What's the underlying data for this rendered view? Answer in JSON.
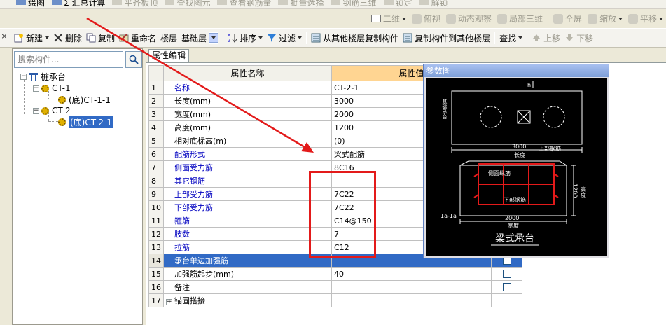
{
  "toolbar_top": {
    "items": [
      {
        "label": "绘图",
        "icon": "draw-icon",
        "disabled": false
      },
      {
        "label": "Σ 汇总计算",
        "icon": "sum-icon",
        "disabled": false
      },
      {
        "label": "平齐板顶",
        "icon": "align-top-icon",
        "disabled": true
      },
      {
        "label": "查找图元",
        "icon": "find-element-icon",
        "disabled": true
      },
      {
        "label": "查看钢筋量",
        "icon": "view-rebar-icon",
        "disabled": true
      },
      {
        "label": "批量选择",
        "icon": "batch-select-icon",
        "disabled": true
      },
      {
        "label": "钢筋三维",
        "icon": "rebar-3d-icon",
        "disabled": true
      },
      {
        "label": "锁定",
        "icon": "lock-icon",
        "disabled": true
      },
      {
        "label": "解锁",
        "icon": "unlock-icon",
        "disabled": true
      }
    ]
  },
  "toolbar_view": {
    "view_mode": "二维",
    "items": [
      {
        "label": "俯视",
        "icon": "top-view-icon"
      },
      {
        "label": "动态观察",
        "icon": "orbit-icon"
      },
      {
        "label": "局部三维",
        "icon": "local-3d-icon"
      },
      {
        "label": "全屏",
        "icon": "fullscreen-icon"
      },
      {
        "label": "缩放",
        "icon": "zoom-icon"
      },
      {
        "label": "平移",
        "icon": "pan-icon"
      }
    ]
  },
  "toolbar_component": {
    "new_label": "新建",
    "delete_label": "删除",
    "copy_label": "复制",
    "rename_label": "重命名",
    "floor_label": "楼层",
    "floor_value": "基础层",
    "sort_label": "排序",
    "filter_label": "过滤",
    "copy_from_label": "从其他楼层复制构件",
    "copy_to_label": "复制构件到其他楼层",
    "find_label": "查找",
    "move_up_label": "上移",
    "move_down_label": "下移"
  },
  "close_glyph": "×",
  "search": {
    "placeholder": "搜索构件..."
  },
  "tree": {
    "root": "桩承台",
    "groups": [
      {
        "name": "CT-1",
        "child": "(底)CT-1-1"
      },
      {
        "name": "CT-2",
        "child": "(底)CT-2-1"
      }
    ]
  },
  "tab_label": "属性编辑",
  "grid": {
    "col_name": "属性名称",
    "col_value": "属性值",
    "rows": [
      {
        "n": "1",
        "name": "名称",
        "value": "CT-2-1",
        "blue": true,
        "check": false
      },
      {
        "n": "2",
        "name": "长度(mm)",
        "value": "3000",
        "blue": false,
        "check": false
      },
      {
        "n": "3",
        "name": "宽度(mm)",
        "value": "2000",
        "blue": false,
        "check": false
      },
      {
        "n": "4",
        "name": "高度(mm)",
        "value": "1200",
        "blue": false,
        "check": false
      },
      {
        "n": "5",
        "name": "相对底标高(m)",
        "value": "(0)",
        "blue": false,
        "check": false
      },
      {
        "n": "6",
        "name": "配筋形式",
        "value": "梁式配筋",
        "blue": true,
        "check": false
      },
      {
        "n": "7",
        "name": "侧面受力筋",
        "value": "8C16",
        "blue": true,
        "check": false
      },
      {
        "n": "8",
        "name": "其它钢筋",
        "value": "",
        "blue": true,
        "check": false
      },
      {
        "n": "9",
        "name": "上部受力筋",
        "value": "7C22",
        "blue": true,
        "check": false
      },
      {
        "n": "10",
        "name": "下部受力筋",
        "value": "7C22",
        "blue": true,
        "check": false
      },
      {
        "n": "11",
        "name": "箍筋",
        "value": "C14@150",
        "blue": true,
        "check": false
      },
      {
        "n": "12",
        "name": "肢数",
        "value": "7",
        "blue": true,
        "check": false
      },
      {
        "n": "13",
        "name": "拉筋",
        "value": "C12",
        "blue": true,
        "check": false
      },
      {
        "n": "14",
        "name": "承台单边加强筋",
        "value": "",
        "blue": false,
        "check": true,
        "active": true
      },
      {
        "n": "15",
        "name": "加强筋起步(mm)",
        "value": "40",
        "blue": false,
        "check": true
      },
      {
        "n": "16",
        "name": "备注",
        "value": "",
        "blue": false,
        "check": true
      },
      {
        "n": "17",
        "name": "锚固搭接",
        "value": "",
        "blue": false,
        "check": false,
        "expand": true
      }
    ]
  },
  "param_window": {
    "title": "参数图",
    "labels": {
      "h": "h",
      "stub_a": "基础承台",
      "len_dim": "3000",
      "len_label": "长度",
      "top_rebar": "上部钢筋",
      "side_rebar": "侧面纵筋",
      "height_dim": "1200",
      "height_label": "高度",
      "bottom_rebar": "下部钢筋",
      "section": "1a-1a",
      "width_dim": "2000",
      "width_label": "宽度",
      "caption": "梁式承台"
    }
  },
  "colors": {
    "annotation_red": "#e31a1a",
    "selection_blue": "#316ac5",
    "header_orange": "#ffd592"
  }
}
